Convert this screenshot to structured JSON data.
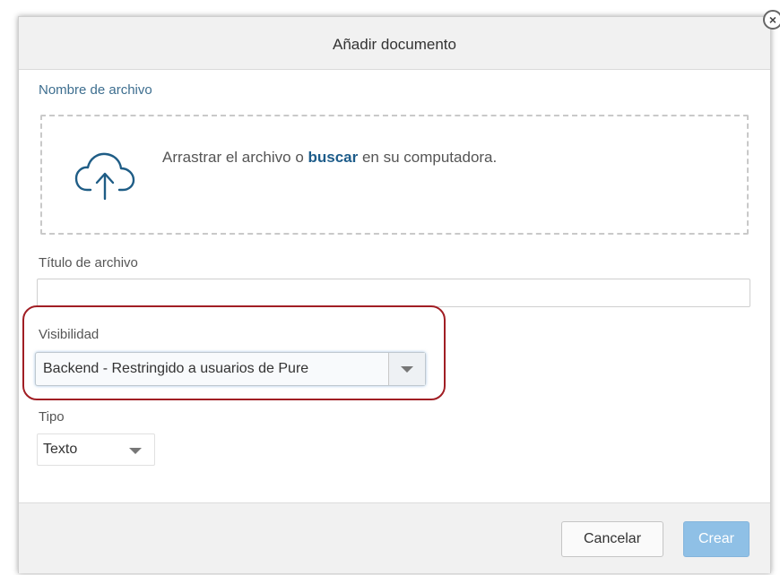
{
  "dialog": {
    "title": "Añadir documento",
    "close_icon": "close-icon"
  },
  "file_name": {
    "label": "Nombre de archivo",
    "dropzone": {
      "icon": "cloud-upload-icon",
      "text_before": "Arrastrar el archivo o ",
      "link": "buscar",
      "text_after": " en su computadora."
    }
  },
  "file_title": {
    "label": "Título de archivo",
    "value": ""
  },
  "visibility": {
    "label": "Visibilidad",
    "selected": "Backend - Restringido a usuarios de Pure",
    "highlight_color": "#a11e24"
  },
  "type": {
    "label": "Tipo",
    "selected": "Texto"
  },
  "footer": {
    "cancel_label": "Cancelar",
    "create_label": "Crear",
    "create_color": "#8fc0e6"
  }
}
